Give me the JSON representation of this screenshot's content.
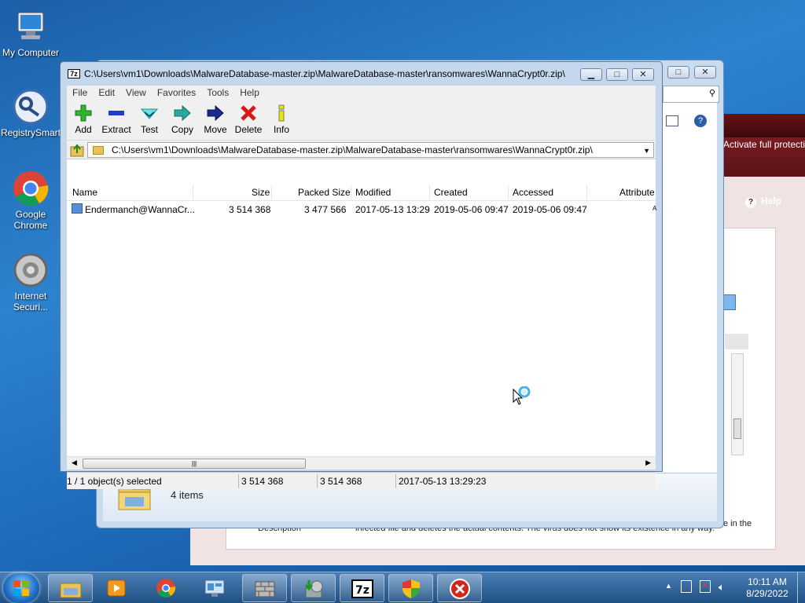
{
  "desktop": {
    "icons": [
      {
        "label": "My Computer",
        "icon": "computer-icon"
      },
      {
        "label": "RegistrySmart",
        "icon": "registry-icon"
      },
      {
        "label": "Google Chrome",
        "icon": "chrome-icon"
      },
      {
        "label": "Internet Securi...",
        "icon": "security-icon"
      }
    ]
  },
  "background_av": {
    "activate_text": "Activate full protection",
    "help_label": "Help",
    "description_label": "Description",
    "description_text_end": "e in the",
    "description_text": "infected file and deletes the actual contents. The virus does not show its existence in any way."
  },
  "explorer": {
    "items_count": "4 items"
  },
  "zip": {
    "title": "C:\\Users\\vm1\\Downloads\\MalwareDatabase-master.zip\\MalwareDatabase-master\\ransomwares\\WannaCrypt0r.zip\\",
    "app_icon_text": "7z",
    "menu": [
      "File",
      "Edit",
      "View",
      "Favorites",
      "Tools",
      "Help"
    ],
    "toolbar": [
      {
        "label": "Add",
        "icon": "add-icon"
      },
      {
        "label": "Extract",
        "icon": "extract-icon"
      },
      {
        "label": "Test",
        "icon": "test-icon"
      },
      {
        "label": "Copy",
        "icon": "copy-icon"
      },
      {
        "label": "Move",
        "icon": "move-icon"
      },
      {
        "label": "Delete",
        "icon": "delete-icon"
      },
      {
        "label": "Info",
        "icon": "info-icon"
      }
    ],
    "address": "C:\\Users\\vm1\\Downloads\\MalwareDatabase-master.zip\\MalwareDatabase-master\\ransomwares\\WannaCrypt0r.zip\\",
    "columns": [
      "Name",
      "Size",
      "Packed Size",
      "Modified",
      "Created",
      "Accessed",
      "Attribute"
    ],
    "rows": [
      {
        "name": "Endermanch@WannaCr...",
        "size": "3 514 368",
        "packed": "3 477 566",
        "modified": "2017-05-13 13:29",
        "created": "2019-05-06 09:47",
        "accessed": "2019-05-06 09:47",
        "attr": "A"
      }
    ],
    "status": {
      "selected": "1 / 1 object(s) selected",
      "size": "3 514 368",
      "packed": "3 514 368",
      "modified": "2017-05-13 13:29:23"
    }
  },
  "taskbar": {
    "buttons": [
      "explorer-icon",
      "media-player-icon",
      "chrome-icon",
      "control-panel-icon",
      "firewall-icon",
      "installer-icon",
      "7zip-icon",
      "shield-icon",
      "av-error-icon"
    ],
    "clock_time": "10:11 AM",
    "clock_date": "8/29/2022"
  }
}
